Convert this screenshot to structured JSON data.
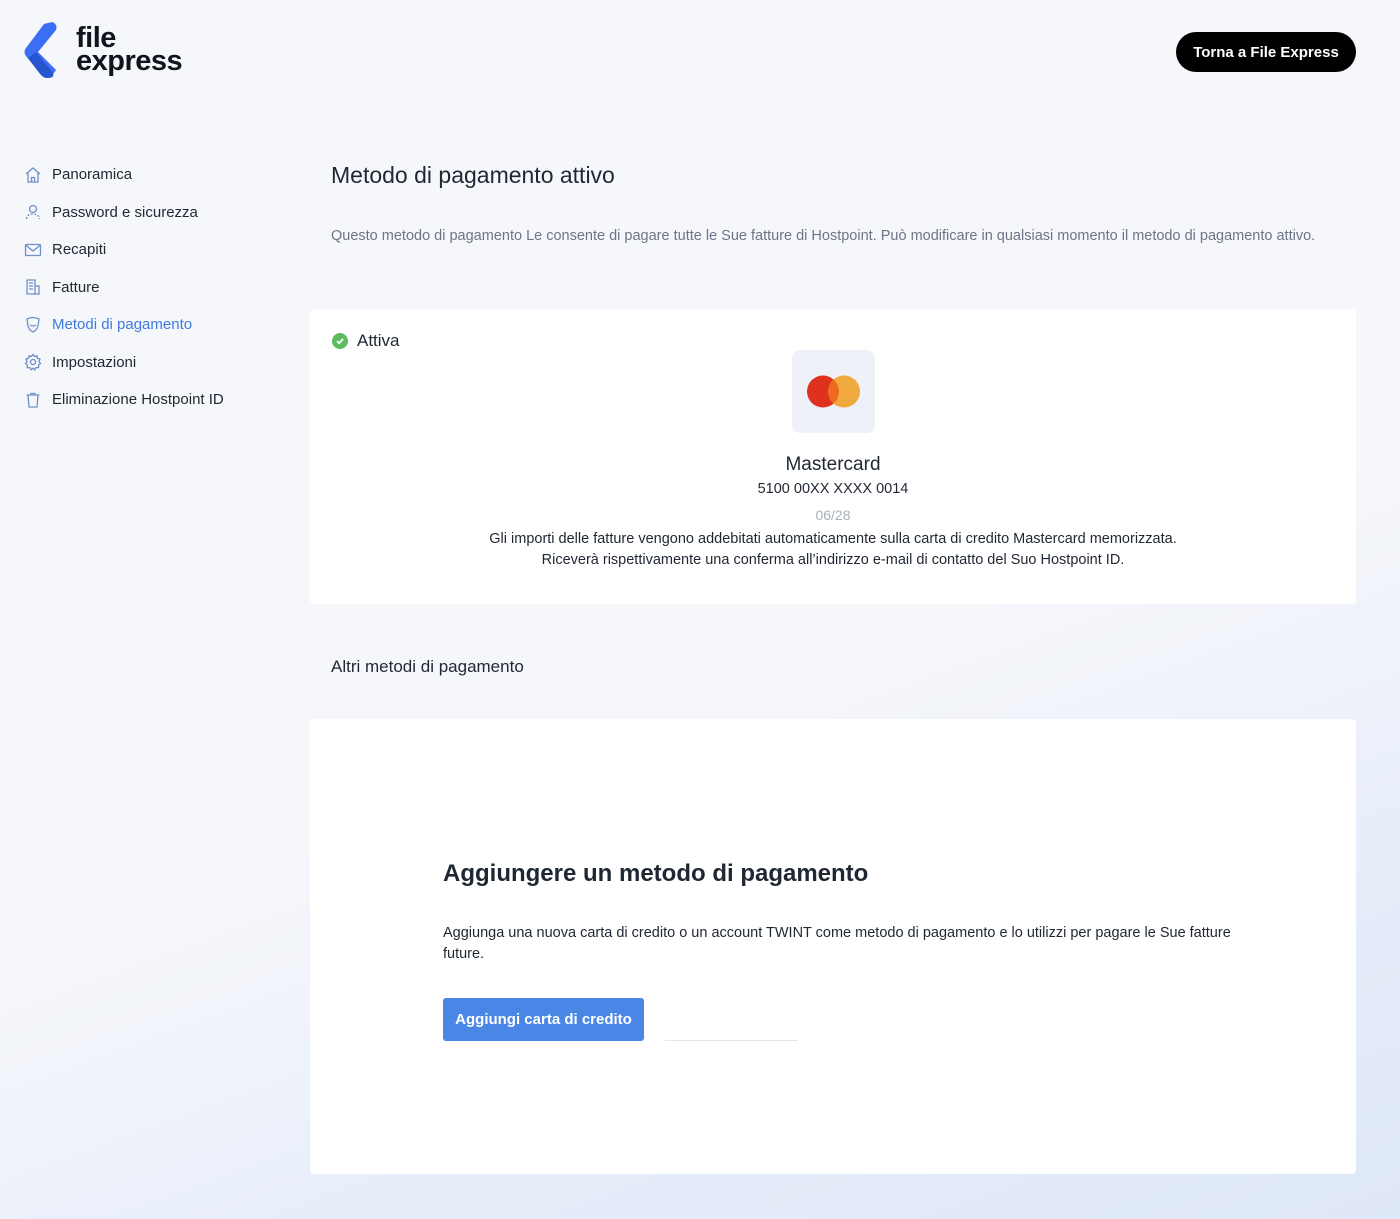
{
  "brand": {
    "line1": "file",
    "line2": "express"
  },
  "header": {
    "back_button": "Torna a File Express"
  },
  "sidebar": {
    "items": [
      {
        "label": "Panoramica",
        "icon": "home-icon"
      },
      {
        "label": "Password e sicurezza",
        "icon": "user-icon"
      },
      {
        "label": "Recapiti",
        "icon": "envelope-icon"
      },
      {
        "label": "Fatture",
        "icon": "invoice-icon"
      },
      {
        "label": "Metodi di pagamento",
        "icon": "payment-icon",
        "active": true
      },
      {
        "label": "Impostazioni",
        "icon": "gear-icon"
      },
      {
        "label": "Eliminazione Hostpoint ID",
        "icon": "trash-icon"
      }
    ]
  },
  "main": {
    "title": "Metodo di pagamento attivo",
    "intro": "Questo metodo di pagamento Le consente di pagare tutte le Sue fatture di Hostpoint. Può modificare in qualsiasi momento il metodo di pagamento attivo.",
    "active_card": {
      "status": "Attiva",
      "brand": "Mastercard",
      "number": "5100 00XX XXXX 0014",
      "expiry": "06/28",
      "info_line1": "Gli importi delle fatture vengono addebitati automaticamente sulla carta di credito Mastercard memorizzata.",
      "info_line2": "Riceverà rispettivamente una conferma all’indirizzo e-mail di contatto del Suo Hostpoint ID."
    },
    "other_title": "Altri metodi di pagamento",
    "add": {
      "title": "Aggiungere un metodo di pagamento",
      "description": "Aggiunga una nuova carta di credito o un account TWINT come metodo di pagamento e lo utilizzi per pagare le Sue fatture future.",
      "button": "Aggiungi carta di credito"
    }
  },
  "colors": {
    "accent": "#3f7ae0",
    "button": "#4a86e6",
    "success": "#5dbb63",
    "mc_red": "#e0301e",
    "mc_orange": "#f0a32e"
  }
}
